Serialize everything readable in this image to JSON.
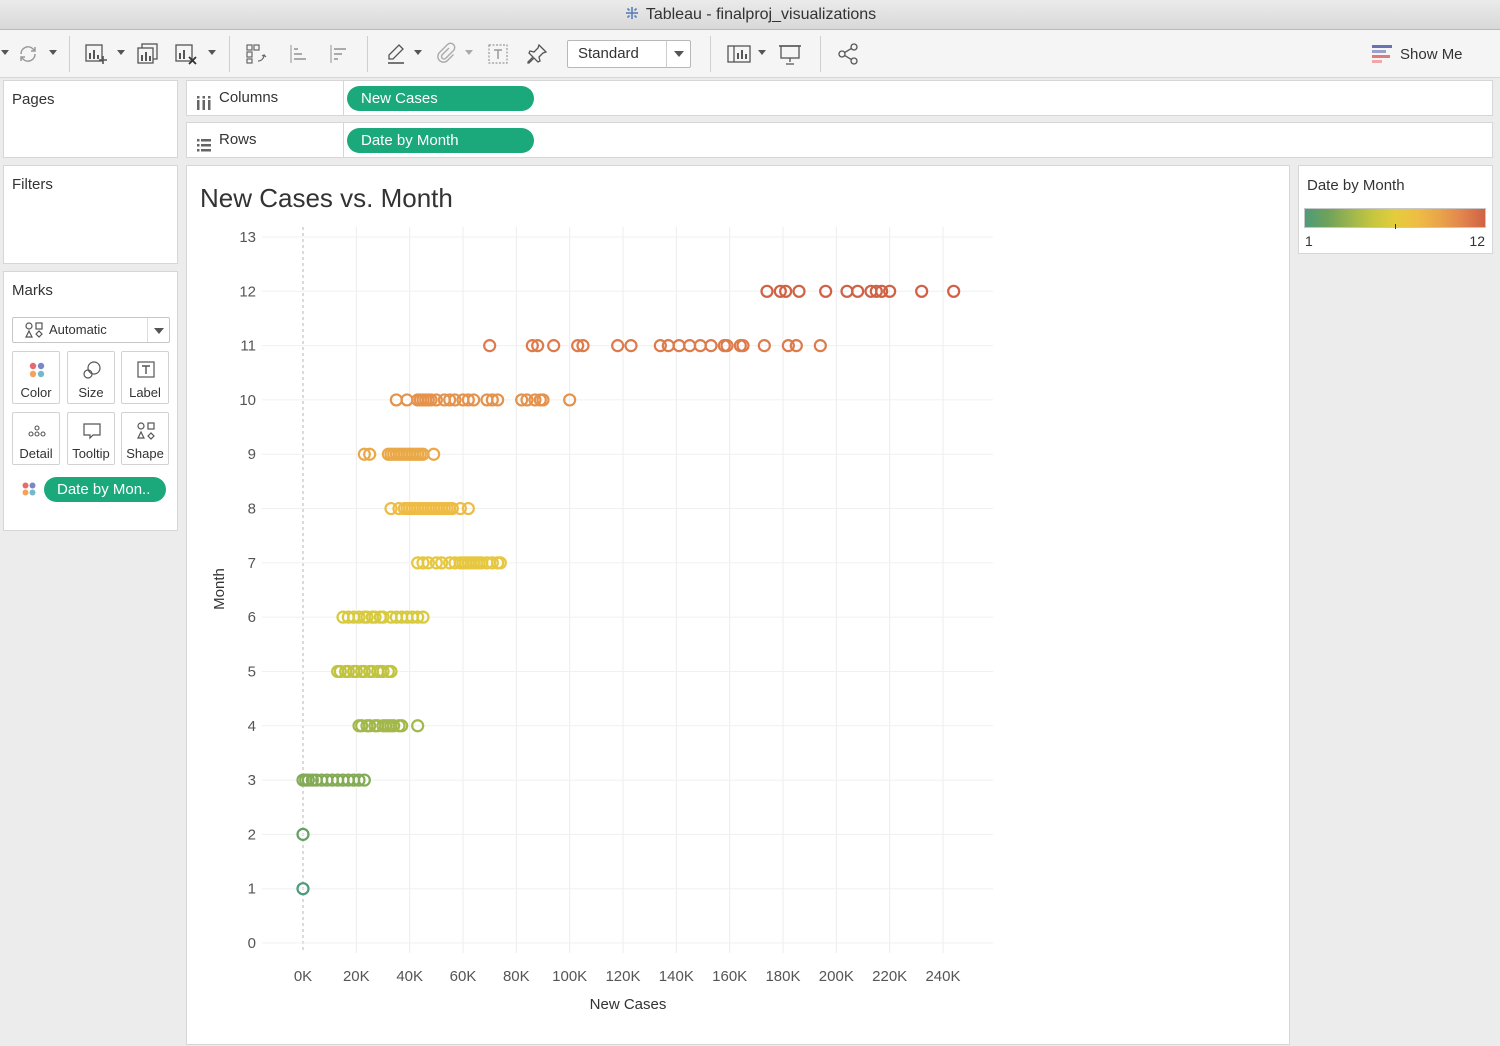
{
  "window": {
    "title": "Tableau - finalproj_visualizations"
  },
  "toolbar": {
    "fit_value": "Standard",
    "show_me_label": "Show Me"
  },
  "cards": {
    "pages_title": "Pages",
    "filters_title": "Filters",
    "marks_title": "Marks"
  },
  "marks": {
    "type": "Automatic",
    "buttons": [
      "Color",
      "Size",
      "Label",
      "Detail",
      "Tooltip",
      "Shape"
    ],
    "pill": "Date by Mon.."
  },
  "shelves": {
    "columns_label": "Columns",
    "columns_pill": "New Cases",
    "rows_label": "Rows",
    "rows_pill": "Date by Month"
  },
  "legend": {
    "title": "Date by Month",
    "min": "1",
    "max": "12",
    "colors": [
      "#4e9b7a",
      "#6ea25a",
      "#9cb54e",
      "#c5c63f",
      "#e3cd3c",
      "#efbd45",
      "#e9a44a",
      "#e2844e",
      "#cf6244"
    ]
  },
  "chart_data": {
    "type": "scatter",
    "title": "New Cases vs. Month",
    "xlabel": "New Cases",
    "ylabel": "Month",
    "xlim": [
      0,
      240000
    ],
    "ylim": [
      0,
      13
    ],
    "x_ticks": [
      "0K",
      "20K",
      "40K",
      "60K",
      "80K",
      "100K",
      "120K",
      "140K",
      "160K",
      "180K",
      "200K",
      "220K",
      "240K"
    ],
    "y_ticks": [
      "0",
      "1",
      "2",
      "3",
      "4",
      "5",
      "6",
      "7",
      "8",
      "9",
      "10",
      "11",
      "12",
      "13"
    ],
    "marker": "open circle",
    "color_by": "Date by Month",
    "series": [
      {
        "month": 1,
        "values": [
          0
        ]
      },
      {
        "month": 2,
        "values": [
          0
        ]
      },
      {
        "month": 3,
        "values": [
          0,
          1000,
          2000,
          3500,
          5000,
          7000,
          9000,
          11000,
          13000,
          15000,
          17000,
          19000,
          21000,
          23000
        ]
      },
      {
        "month": 4,
        "values": [
          21000,
          22000,
          24000,
          25000,
          27000,
          28000,
          30000,
          31000,
          32000,
          33000,
          34000,
          36000,
          37000,
          43000
        ]
      },
      {
        "month": 5,
        "values": [
          13000,
          14000,
          16000,
          17000,
          19000,
          20000,
          22000,
          23000,
          25000,
          26000,
          28000,
          29000,
          30000,
          32000,
          33000
        ]
      },
      {
        "month": 6,
        "values": [
          15000,
          17000,
          19000,
          21000,
          23000,
          24000,
          26000,
          27000,
          29000,
          30000,
          33000,
          35000,
          37000,
          39000,
          41000,
          43000,
          45000
        ]
      },
      {
        "month": 7,
        "values": [
          43000,
          45000,
          47000,
          50000,
          52000,
          55000,
          57000,
          59000,
          60000,
          61000,
          62000,
          63000,
          64000,
          65000,
          66000,
          67000,
          69000,
          71000,
          73000,
          74000
        ]
      },
      {
        "month": 8,
        "values": [
          33000,
          36000,
          38000,
          39000,
          40000,
          41000,
          42000,
          43000,
          44000,
          45000,
          46000,
          47000,
          48000,
          49000,
          50000,
          51000,
          52000,
          53000,
          54000,
          55000,
          56000,
          59000,
          62000
        ]
      },
      {
        "month": 9,
        "values": [
          23000,
          25000,
          32000,
          33000,
          34000,
          35000,
          36000,
          37000,
          38000,
          39000,
          40000,
          41000,
          42000,
          43000,
          44000,
          45000,
          49000
        ]
      },
      {
        "month": 10,
        "values": [
          35000,
          39000,
          43000,
          44000,
          45000,
          46000,
          47000,
          48000,
          50000,
          53000,
          55000,
          57000,
          60000,
          62000,
          64000,
          69000,
          71000,
          73000,
          82000,
          84000,
          87000,
          89000,
          90000,
          100000
        ]
      },
      {
        "month": 11,
        "values": [
          70000,
          86000,
          88000,
          94000,
          103000,
          105000,
          118000,
          123000,
          134000,
          137000,
          141000,
          145000,
          149000,
          153000,
          158000,
          159000,
          164000,
          165000,
          173000,
          182000,
          185000,
          194000
        ]
      },
      {
        "month": 12,
        "values": [
          174000,
          179000,
          181000,
          186000,
          196000,
          204000,
          208000,
          213000,
          215000,
          217000,
          220000,
          232000,
          244000
        ]
      }
    ]
  }
}
